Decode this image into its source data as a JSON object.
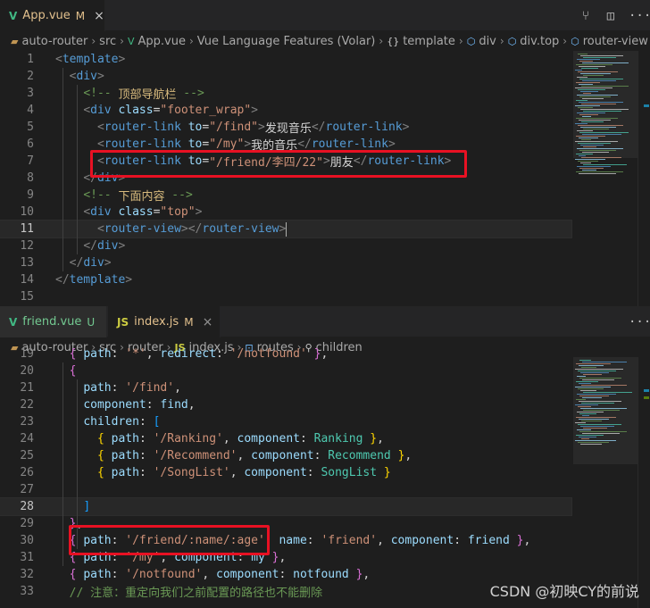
{
  "top": {
    "tab": {
      "icon": "vue-icon",
      "label": "App.vue",
      "status": "M",
      "close": "×"
    },
    "actions": [
      {
        "name": "source-control-icon",
        "glyph": "⑂"
      },
      {
        "name": "split-editor-icon",
        "glyph": "◫"
      },
      {
        "name": "more-actions-icon",
        "glyph": "···"
      }
    ],
    "breadcrumb": {
      "items": [
        "auto-router",
        "src",
        "App.vue",
        "Vue Language Features (Volar)",
        "template",
        "div",
        "div.top",
        "router-view"
      ],
      "brace": "{}"
    },
    "lines": [
      {
        "n": "1",
        "segs": [
          [
            "t-punct",
            "<"
          ],
          [
            "t-tag",
            "template"
          ],
          [
            "t-punct",
            ">"
          ]
        ]
      },
      {
        "n": "2",
        "segs": [
          [
            "t-text",
            "  "
          ],
          [
            "t-punct",
            "<"
          ],
          [
            "t-tag",
            "div"
          ],
          [
            "t-punct",
            ">"
          ]
        ]
      },
      {
        "n": "3",
        "segs": [
          [
            "t-text",
            "    "
          ],
          [
            "t-cmt",
            "<!-- "
          ],
          [
            "t-cmt-zh",
            "顶部导航栏"
          ],
          [
            "t-cmt",
            " -->"
          ]
        ]
      },
      {
        "n": "4",
        "segs": [
          [
            "t-text",
            "    "
          ],
          [
            "t-punct",
            "<"
          ],
          [
            "t-tag",
            "div"
          ],
          [
            "t-text",
            " "
          ],
          [
            "t-attr",
            "class"
          ],
          [
            "t-text",
            "="
          ],
          [
            "t-str",
            "\"footer_wrap\""
          ],
          [
            "t-punct",
            ">"
          ]
        ]
      },
      {
        "n": "5",
        "segs": [
          [
            "t-text",
            "      "
          ],
          [
            "t-punct",
            "<"
          ],
          [
            "t-tag",
            "router-link"
          ],
          [
            "t-text",
            " "
          ],
          [
            "t-attr",
            "to"
          ],
          [
            "t-text",
            "="
          ],
          [
            "t-str",
            "\"/find\""
          ],
          [
            "t-punct",
            ">"
          ],
          [
            "t-text",
            "发现音乐"
          ],
          [
            "t-punct",
            "</"
          ],
          [
            "t-tag",
            "router-link"
          ],
          [
            "t-punct",
            ">"
          ]
        ]
      },
      {
        "n": "6",
        "segs": [
          [
            "t-text",
            "      "
          ],
          [
            "t-punct",
            "<"
          ],
          [
            "t-tag",
            "router-link"
          ],
          [
            "t-text",
            " "
          ],
          [
            "t-attr",
            "to"
          ],
          [
            "t-text",
            "="
          ],
          [
            "t-str",
            "\"/my\""
          ],
          [
            "t-punct",
            ">"
          ],
          [
            "t-text",
            "我的音乐"
          ],
          [
            "t-punct",
            "</"
          ],
          [
            "t-tag",
            "router-link"
          ],
          [
            "t-punct",
            ">"
          ]
        ]
      },
      {
        "n": "7",
        "segs": [
          [
            "t-text",
            "      "
          ],
          [
            "t-punct",
            "<"
          ],
          [
            "t-tag",
            "router-link"
          ],
          [
            "t-text",
            " "
          ],
          [
            "t-attr",
            "to"
          ],
          [
            "t-text",
            "="
          ],
          [
            "t-str",
            "\"/friend/李四/22\""
          ],
          [
            "t-punct",
            ">"
          ],
          [
            "t-text",
            "朋友"
          ],
          [
            "t-punct",
            "</"
          ],
          [
            "t-tag",
            "router-link"
          ],
          [
            "t-punct",
            ">"
          ]
        ]
      },
      {
        "n": "8",
        "segs": [
          [
            "t-text",
            "    "
          ],
          [
            "t-punct",
            "</"
          ],
          [
            "t-tag",
            "div"
          ],
          [
            "t-punct",
            ">"
          ]
        ]
      },
      {
        "n": "9",
        "segs": [
          [
            "t-text",
            "    "
          ],
          [
            "t-cmt",
            "<!-- "
          ],
          [
            "t-cmt-zh",
            "下面内容"
          ],
          [
            "t-cmt",
            " -->"
          ]
        ]
      },
      {
        "n": "10",
        "segs": [
          [
            "t-text",
            "    "
          ],
          [
            "t-punct",
            "<"
          ],
          [
            "t-tag",
            "div"
          ],
          [
            "t-text",
            " "
          ],
          [
            "t-attr",
            "class"
          ],
          [
            "t-text",
            "="
          ],
          [
            "t-str",
            "\"top\""
          ],
          [
            "t-punct",
            ">"
          ]
        ]
      },
      {
        "n": "11",
        "segs": [
          [
            "t-text",
            "      "
          ],
          [
            "t-punct",
            "<"
          ],
          [
            "t-tag",
            "router-view"
          ],
          [
            "t-punct",
            "></"
          ],
          [
            "t-tag",
            "router-view"
          ],
          [
            "t-punct",
            ">"
          ]
        ],
        "current": true
      },
      {
        "n": "12",
        "segs": [
          [
            "t-text",
            "    "
          ],
          [
            "t-punct",
            "</"
          ],
          [
            "t-tag",
            "div"
          ],
          [
            "t-punct",
            ">"
          ]
        ]
      },
      {
        "n": "13",
        "segs": [
          [
            "t-text",
            "  "
          ],
          [
            "t-punct",
            "</"
          ],
          [
            "t-tag",
            "div"
          ],
          [
            "t-punct",
            ">"
          ]
        ]
      },
      {
        "n": "14",
        "segs": [
          [
            "t-punct",
            "</"
          ],
          [
            "t-tag",
            "template"
          ],
          [
            "t-punct",
            ">"
          ]
        ]
      },
      {
        "n": "15",
        "segs": []
      }
    ]
  },
  "bottom": {
    "tabs": [
      {
        "icon": "vue-icon",
        "label": "friend.vue",
        "status": "U"
      },
      {
        "icon": "js-icon",
        "label": "index.js",
        "status": "M",
        "close": "×"
      }
    ],
    "actions": [
      {
        "name": "more-actions-icon",
        "glyph": "···"
      }
    ],
    "breadcrumb": {
      "items": [
        "auto-router",
        "src",
        "router",
        "index.js",
        "routes",
        "children"
      ]
    },
    "lines": [
      {
        "n": "19",
        "segs": [
          [
            "t-text",
            "  "
          ],
          [
            "t-brace",
            "{"
          ],
          [
            "t-text",
            " "
          ],
          [
            "t-prop",
            "path"
          ],
          [
            "t-text",
            ": "
          ],
          [
            "t-str",
            "'*'"
          ],
          [
            "t-text",
            ", "
          ],
          [
            "t-prop",
            "redirect"
          ],
          [
            "t-text",
            ": "
          ],
          [
            "t-str",
            "'/notfound'"
          ],
          [
            "t-text",
            " "
          ],
          [
            "t-brace",
            "}"
          ],
          [
            "t-text",
            ","
          ]
        ]
      },
      {
        "n": "20",
        "segs": [
          [
            "t-text",
            "  "
          ],
          [
            "t-brace",
            "{"
          ]
        ]
      },
      {
        "n": "21",
        "segs": [
          [
            "t-text",
            "    "
          ],
          [
            "t-prop",
            "path"
          ],
          [
            "t-text",
            ": "
          ],
          [
            "t-str",
            "'/find'"
          ],
          [
            "t-text",
            ","
          ]
        ]
      },
      {
        "n": "22",
        "segs": [
          [
            "t-text",
            "    "
          ],
          [
            "t-prop",
            "component"
          ],
          [
            "t-text",
            ": "
          ],
          [
            "t-var",
            "find"
          ],
          [
            "t-text",
            ","
          ]
        ]
      },
      {
        "n": "23",
        "segs": [
          [
            "t-text",
            "    "
          ],
          [
            "t-prop",
            "children"
          ],
          [
            "t-text",
            ": "
          ],
          [
            "t-brack",
            "["
          ]
        ]
      },
      {
        "n": "24",
        "segs": [
          [
            "t-text",
            "      "
          ],
          [
            "t-brace2",
            "{"
          ],
          [
            "t-text",
            " "
          ],
          [
            "t-prop",
            "path"
          ],
          [
            "t-text",
            ": "
          ],
          [
            "t-str",
            "'/Ranking'"
          ],
          [
            "t-text",
            ", "
          ],
          [
            "t-prop",
            "component"
          ],
          [
            "t-text",
            ": "
          ],
          [
            "t-ident",
            "Ranking"
          ],
          [
            "t-text",
            " "
          ],
          [
            "t-brace2",
            "}"
          ],
          [
            "t-text",
            ","
          ]
        ]
      },
      {
        "n": "25",
        "segs": [
          [
            "t-text",
            "      "
          ],
          [
            "t-brace2",
            "{"
          ],
          [
            "t-text",
            " "
          ],
          [
            "t-prop",
            "path"
          ],
          [
            "t-text",
            ": "
          ],
          [
            "t-str",
            "'/Recommend'"
          ],
          [
            "t-text",
            ", "
          ],
          [
            "t-prop",
            "component"
          ],
          [
            "t-text",
            ": "
          ],
          [
            "t-ident",
            "Recommend"
          ],
          [
            "t-text",
            " "
          ],
          [
            "t-brace2",
            "}"
          ],
          [
            "t-text",
            ","
          ]
        ]
      },
      {
        "n": "26",
        "segs": [
          [
            "t-text",
            "      "
          ],
          [
            "t-brace2",
            "{"
          ],
          [
            "t-text",
            " "
          ],
          [
            "t-prop",
            "path"
          ],
          [
            "t-text",
            ": "
          ],
          [
            "t-str",
            "'/SongList'"
          ],
          [
            "t-text",
            ", "
          ],
          [
            "t-prop",
            "component"
          ],
          [
            "t-text",
            ": "
          ],
          [
            "t-ident",
            "SongList"
          ],
          [
            "t-text",
            " "
          ],
          [
            "t-brace2",
            "}"
          ]
        ]
      },
      {
        "n": "27",
        "segs": []
      },
      {
        "n": "28",
        "segs": [
          [
            "t-text",
            "    "
          ],
          [
            "t-brack",
            "]"
          ]
        ],
        "current": true
      },
      {
        "n": "29",
        "segs": [
          [
            "t-text",
            "  "
          ],
          [
            "t-brace",
            "}"
          ],
          [
            "t-text",
            ","
          ]
        ]
      },
      {
        "n": "30",
        "segs": [
          [
            "t-text",
            "  "
          ],
          [
            "t-brace",
            "{"
          ],
          [
            "t-text",
            " "
          ],
          [
            "t-prop",
            "path"
          ],
          [
            "t-text",
            ": "
          ],
          [
            "t-str",
            "'/friend/:name/:age'"
          ],
          [
            "t-text",
            ", "
          ],
          [
            "t-prop",
            "name"
          ],
          [
            "t-text",
            ": "
          ],
          [
            "t-str",
            "'friend'"
          ],
          [
            "t-text",
            ", "
          ],
          [
            "t-prop",
            "component"
          ],
          [
            "t-text",
            ": "
          ],
          [
            "t-var",
            "friend"
          ],
          [
            "t-text",
            " "
          ],
          [
            "t-brace",
            "}"
          ],
          [
            "t-text",
            ","
          ]
        ]
      },
      {
        "n": "31",
        "segs": [
          [
            "t-text",
            "  "
          ],
          [
            "t-brace",
            "{"
          ],
          [
            "t-text",
            " "
          ],
          [
            "t-prop",
            "path"
          ],
          [
            "t-text",
            ": "
          ],
          [
            "t-str",
            "'/my'"
          ],
          [
            "t-text",
            ", "
          ],
          [
            "t-prop",
            "component"
          ],
          [
            "t-text",
            ": "
          ],
          [
            "t-var",
            "my"
          ],
          [
            "t-text",
            " "
          ],
          [
            "t-brace",
            "}"
          ],
          [
            "t-text",
            ","
          ]
        ]
      },
      {
        "n": "32",
        "segs": [
          [
            "t-text",
            "  "
          ],
          [
            "t-brace",
            "{"
          ],
          [
            "t-text",
            " "
          ],
          [
            "t-prop",
            "path"
          ],
          [
            "t-text",
            ": "
          ],
          [
            "t-str",
            "'/notfound'"
          ],
          [
            "t-text",
            ", "
          ],
          [
            "t-prop",
            "component"
          ],
          [
            "t-text",
            ": "
          ],
          [
            "t-var",
            "notfound"
          ],
          [
            "t-text",
            " "
          ],
          [
            "t-brace",
            "}"
          ],
          [
            "t-text",
            ","
          ]
        ]
      },
      {
        "n": "33",
        "segs": [
          [
            "t-text",
            "  "
          ],
          [
            "t-cmt",
            "// 注意：重定向我们之前配置的路径也不能删除"
          ]
        ]
      }
    ]
  },
  "watermark": "CSDN @初映CY的前说"
}
